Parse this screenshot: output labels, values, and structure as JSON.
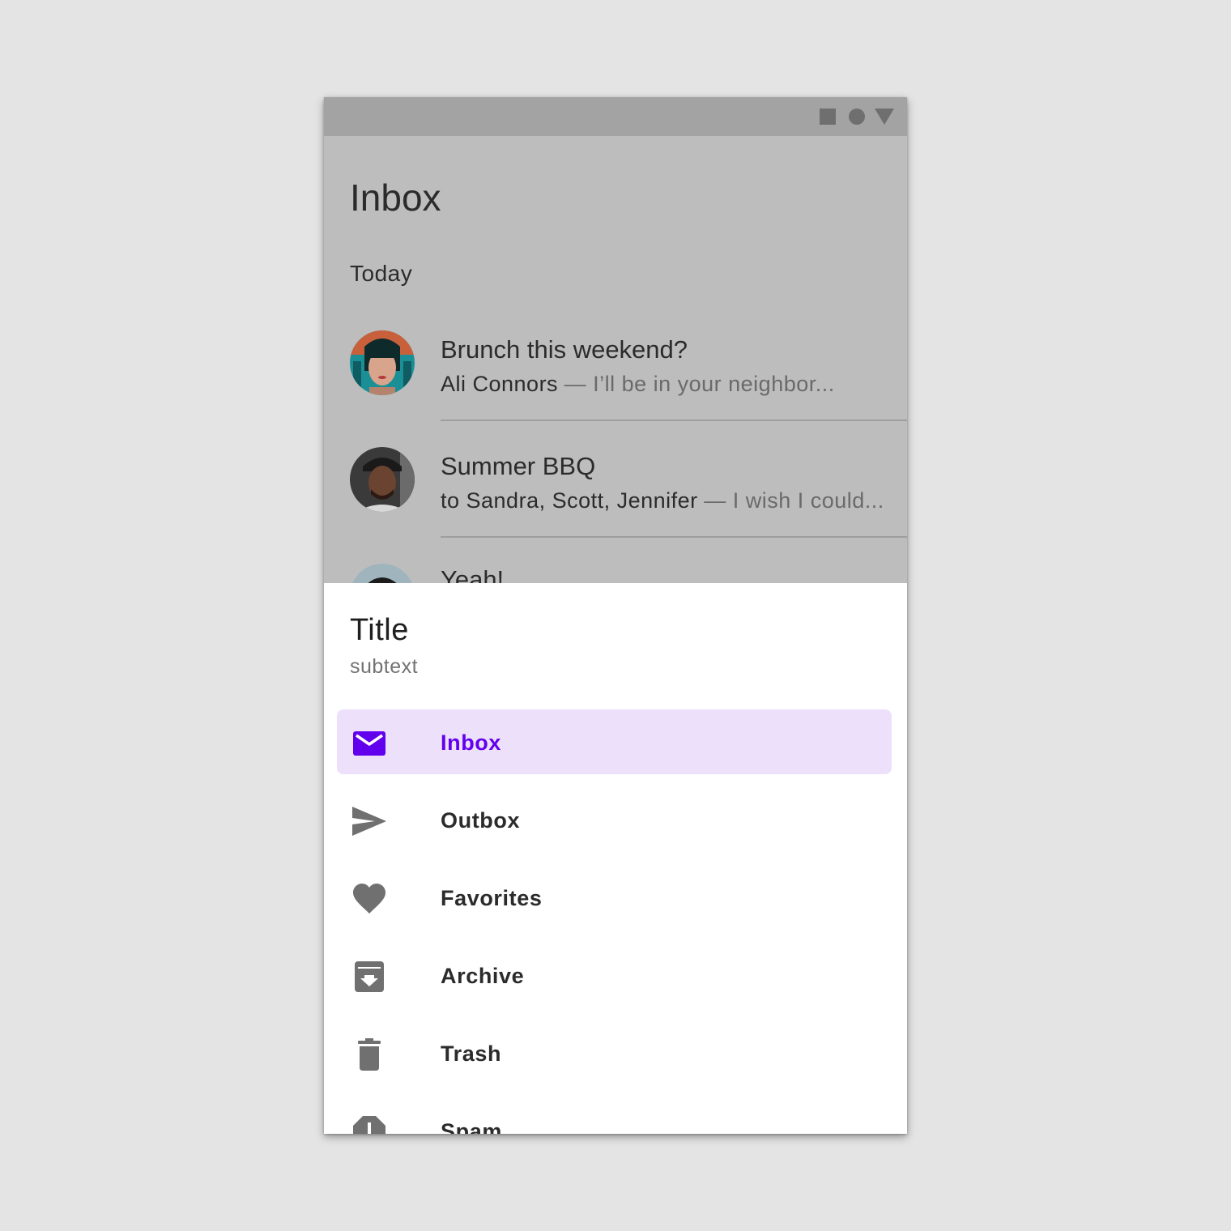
{
  "app": {
    "title": "Inbox",
    "section_label": "Today"
  },
  "emails": [
    {
      "subject": "Brunch this weekend?",
      "sender": "Ali Connors",
      "preview": "— I’ll be in your neighbor..."
    },
    {
      "subject": "Summer BBQ",
      "sender": "to Sandra, Scott, Jennifer",
      "preview": "— I wish I could..."
    },
    {
      "subject": "Yeah!",
      "sender": "",
      "preview": ""
    }
  ],
  "drawer": {
    "title": "Title",
    "subtext": "subtext",
    "items": [
      {
        "label": "Inbox",
        "icon": "mail-icon",
        "active": true
      },
      {
        "label": "Outbox",
        "icon": "send-icon",
        "active": false
      },
      {
        "label": "Favorites",
        "icon": "heart-icon",
        "active": false
      },
      {
        "label": "Archive",
        "icon": "archive-icon",
        "active": false
      },
      {
        "label": "Trash",
        "icon": "trash-icon",
        "active": false
      },
      {
        "label": "Spam",
        "icon": "spam-icon",
        "active": false
      }
    ]
  },
  "colors": {
    "accent": "#6200ee",
    "active_item_bg": "#ede0fb",
    "scrim": "#bdbdbd",
    "status_bar": "#a3a3a3",
    "icon_gray": "#707070",
    "page_background": "#e4e4e4"
  }
}
